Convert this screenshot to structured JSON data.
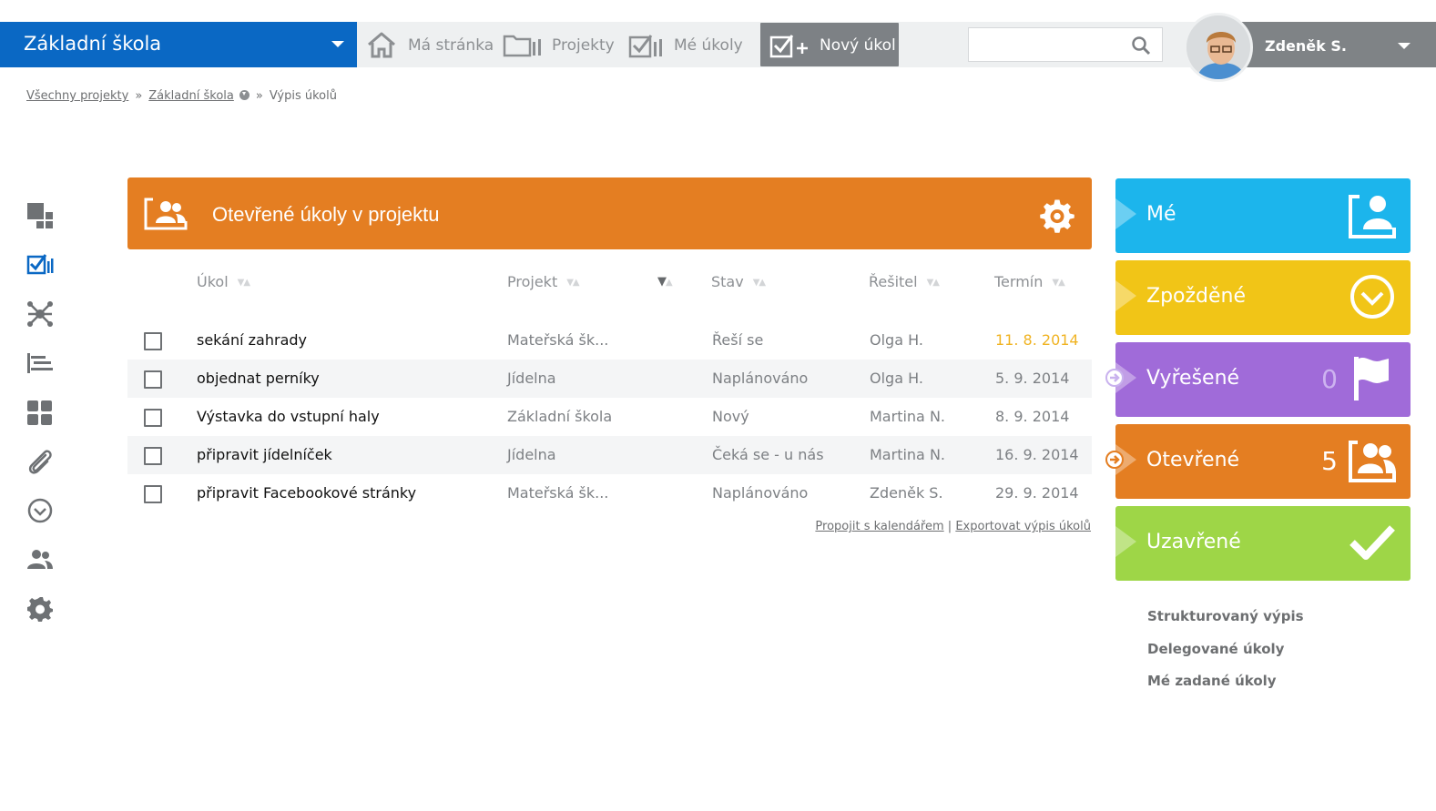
{
  "header": {
    "project_name": "Základní škola",
    "nav": {
      "home": "Má stránka",
      "projects": "Projekty",
      "my_tasks": "Mé úkoly",
      "new_task": "Nový úkol"
    },
    "search": {
      "value": "",
      "placeholder": ""
    },
    "user": {
      "name": "Zdeněk S."
    }
  },
  "breadcrumb": {
    "all_projects": "Všechny projekty",
    "separator": "»",
    "project": "Základní škola",
    "current": "Výpis úkolů"
  },
  "sidebar": {
    "items": [
      "dashboard-icon",
      "tasks-icon",
      "network-icon",
      "gantt-icon",
      "tiles-icon",
      "attachment-icon",
      "clock-icon",
      "people-icon",
      "gear-icon"
    ]
  },
  "panel": {
    "title": "Otevřené úkoly v projektu",
    "columns": {
      "task": "Úkol",
      "project": "Projekt",
      "status": "Stav",
      "assignee": "Řešitel",
      "due": "Termín"
    },
    "rows": [
      {
        "task": "sekání zahrady",
        "project": "Mateřská šk...",
        "status": "Řeší se",
        "assignee": "Olga H.",
        "due": "11. 8. 2014",
        "due_overdue": true
      },
      {
        "task": "objednat perníky",
        "project": "Jídelna",
        "status": "Naplánováno",
        "assignee": "Olga H.",
        "due": "5. 9. 2014",
        "due_overdue": false
      },
      {
        "task": "Výstavka do vstupní haly",
        "project": "Základní škola",
        "status": "Nový",
        "assignee": "Martina N.",
        "due": "8. 9. 2014",
        "due_overdue": false
      },
      {
        "task": "připravit jídelníček",
        "project": "Jídelna",
        "status": "Čeká se - u nás",
        "assignee": "Martina N.",
        "due": "16. 9. 2014",
        "due_overdue": false
      },
      {
        "task": "připravit Facebookové stránky",
        "project": "Mateřská šk...",
        "status": "Naplánováno",
        "assignee": "Zdeněk S.",
        "due": "29. 9. 2014",
        "due_overdue": false
      }
    ],
    "links": {
      "calendar": "Propojit s kalendářem",
      "divider": "|",
      "export": "Exportovat výpis úkolů"
    }
  },
  "filters": {
    "me": {
      "label": "Mé"
    },
    "late": {
      "label": "Zpožděné"
    },
    "solved": {
      "label": "Vyřešené",
      "count": "0"
    },
    "open": {
      "label": "Otevřené",
      "count": "5"
    },
    "closed": {
      "label": "Uzavřené"
    }
  },
  "right_links": [
    "Strukturovaný výpis",
    "Delegované úkoly",
    "Mé zadané úkoly"
  ],
  "colors": {
    "brand_blue": "#0a68c4",
    "orange": "#e47e22",
    "cyan": "#1cb5ec",
    "yellow": "#f1c517",
    "purple": "#a06bd9",
    "green": "#9ed647",
    "overdue": "#f0b322"
  }
}
